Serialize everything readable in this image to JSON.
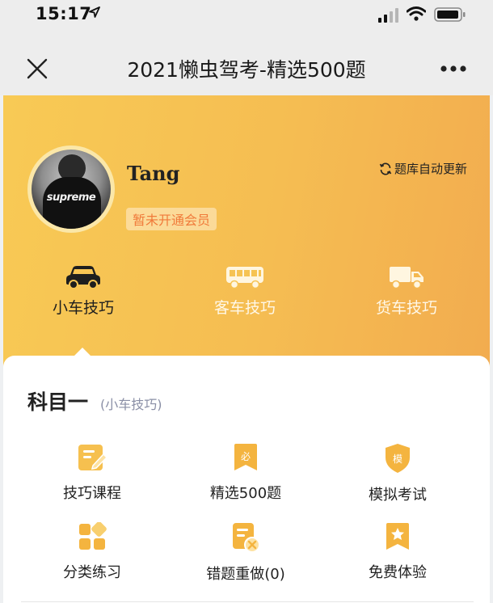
{
  "status_bar": {
    "time": "15:17",
    "icons": [
      "location-arrow-icon",
      "signal-icon",
      "wifi-icon",
      "battery-icon"
    ]
  },
  "nav": {
    "title": "2021懒虫驾考-精选500题",
    "close_icon": "close-icon",
    "more_icon": "more-icon"
  },
  "profile": {
    "name": "Tang",
    "avatar_text": "supreme",
    "member_status": "暂未开通会员",
    "auto_update": "题库自动更新"
  },
  "vehicle_tabs": [
    {
      "label": "小车技巧",
      "icon": "car-icon",
      "active": true
    },
    {
      "label": "客车技巧",
      "icon": "bus-icon",
      "active": false
    },
    {
      "label": "货车技巧",
      "icon": "truck-icon",
      "active": false
    }
  ],
  "section": {
    "title": "科目一",
    "subtitle": "(小车技巧)"
  },
  "grid": [
    {
      "label": "技巧课程",
      "icon": "edit-document-icon"
    },
    {
      "label": "精选500题",
      "icon": "bookmark-bi-icon",
      "icon_text": "必"
    },
    {
      "label": "模拟考试",
      "icon": "shield-mo-icon",
      "icon_text": "模"
    },
    {
      "label": "分类练习",
      "icon": "category-grid-icon"
    },
    {
      "label": "错题重做(0)",
      "icon": "wrong-document-icon"
    },
    {
      "label": "免费体验",
      "icon": "star-bookmark-icon"
    }
  ],
  "colors": {
    "accent": "#f5bd52",
    "icon_gold": "#f4b43f",
    "badge_text": "#f07a3a",
    "subtitle": "#8a8fa6"
  }
}
